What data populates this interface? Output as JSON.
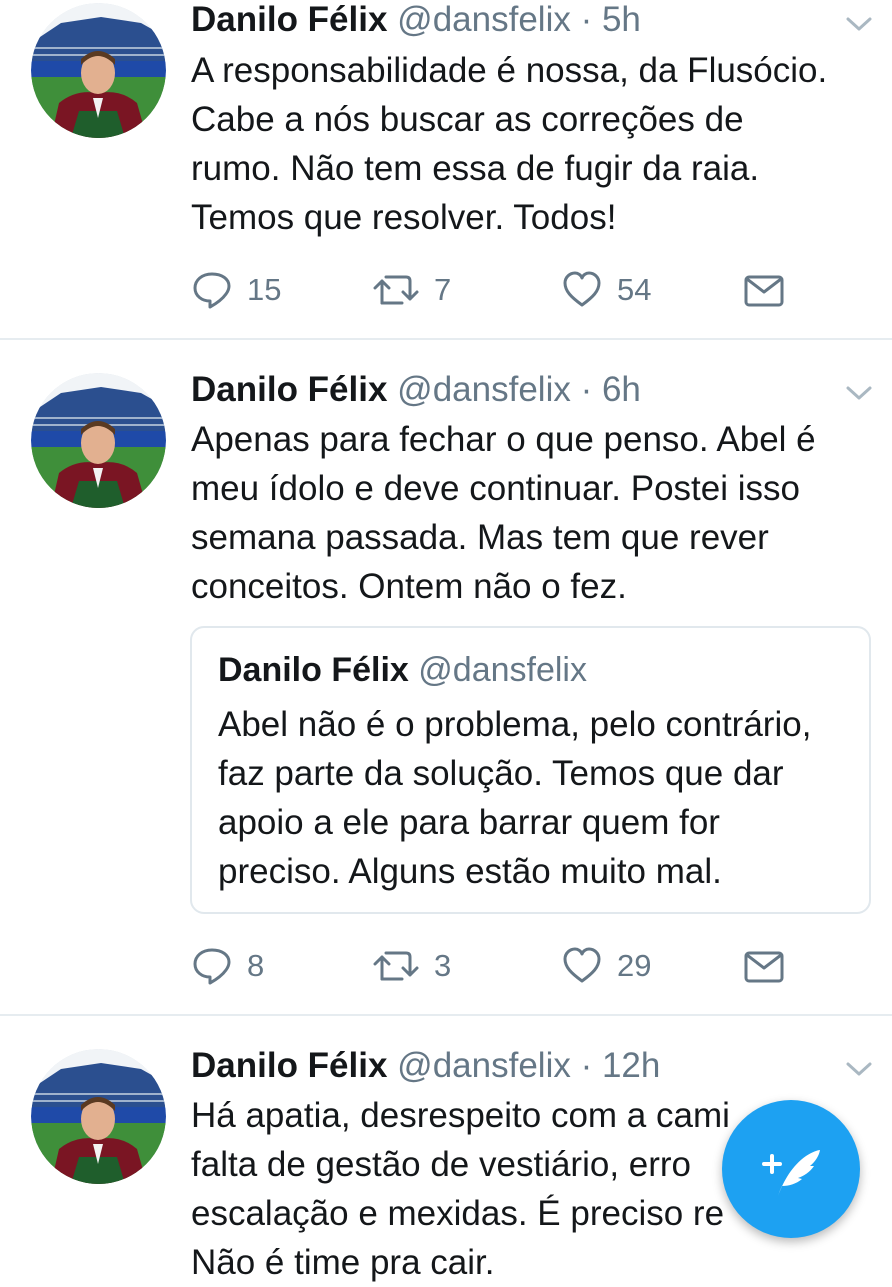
{
  "tweets": [
    {
      "name": "Danilo Félix",
      "handle": "@dansfelix",
      "separator": "·",
      "time": "5h",
      "lines": [
        "A responsabilidade é nossa, da Flusócio.",
        "Cabe a nós buscar as correções de",
        "rumo. Não tem essa de fugir da raia.",
        "Temos que resolver. Todos!"
      ],
      "replies": "15",
      "retweets": "7",
      "likes": "54"
    },
    {
      "name": "Danilo Félix",
      "handle": "@dansfelix",
      "separator": "·",
      "time": "6h",
      "lines": [
        "Apenas para fechar o que penso. Abel é",
        "meu ídolo e deve continuar. Postei isso",
        "semana passada. Mas tem que rever",
        "conceitos. Ontem não o fez."
      ],
      "quote": {
        "name": "Danilo Félix",
        "handle": "@dansfelix",
        "lines": [
          "Abel não é o problema, pelo contrário,",
          "faz parte da solução. Temos que dar",
          "apoio a ele para barrar quem for",
          "preciso. Alguns estão muito mal."
        ]
      },
      "replies": "8",
      "retweets": "3",
      "likes": "29"
    },
    {
      "name": "Danilo Félix",
      "handle": "@dansfelix",
      "separator": "·",
      "time": "12h",
      "lines": [
        "Há apatia, desrespeito com a cami",
        "falta de gestão de vestiário, erro",
        "escalação e mexidas. É preciso re",
        "Não é time pra cair."
      ]
    }
  ],
  "fab": {
    "icon": "compose-tweet-icon",
    "color": "#1da1f2"
  },
  "colors": {
    "text": "#14171a",
    "secondary": "#657786",
    "divider": "#e6ecf0",
    "accent": "#1da1f2"
  }
}
